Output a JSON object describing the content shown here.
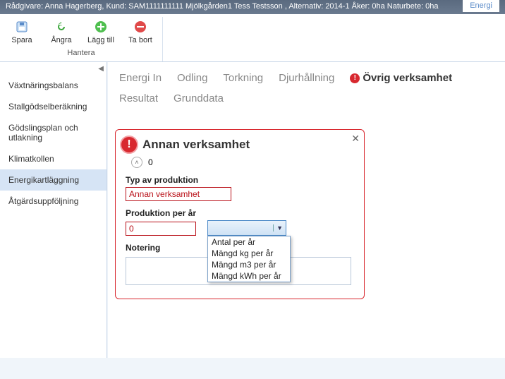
{
  "title_bar": {
    "text": "Rådgivare: Anna Hagerberg, Kund:  SAM1111111111 Mjölkgården1 Tess Testsson , Alternativ:  2014-1 Åker: 0ha Naturbete: 0ha",
    "right_tab": "Energi"
  },
  "ribbon": {
    "buttons": {
      "save": "Spara",
      "undo": "Ångra",
      "add": "Lägg till",
      "delete": "Ta bort"
    },
    "group_label": "Hantera"
  },
  "sidebar": {
    "items": [
      "Växtnäringsbalans",
      "Stallgödselberäkning",
      "Gödslingsplan och utlakning",
      "Klimatkollen",
      "Energikartläggning",
      "Åtgärdsuppföljning"
    ]
  },
  "tabs": {
    "row1": [
      "Energi In",
      "Odling",
      "Torkning",
      "Djurhållning"
    ],
    "row1_alert": "Övrig verksamhet",
    "row2": [
      "Resultat",
      "Grunddata"
    ]
  },
  "card": {
    "title": "Annan verksamhet",
    "sub_value": "0",
    "labels": {
      "type": "Typ av produktion",
      "production": "Produktion per år",
      "notes": "Notering"
    },
    "type_value": "Annan verksamhet",
    "production_value": "0",
    "dropdown_options": [
      "Antal per år",
      "Mängd kg per år",
      "Mängd m3 per år",
      "Mängd kWh per år"
    ]
  }
}
